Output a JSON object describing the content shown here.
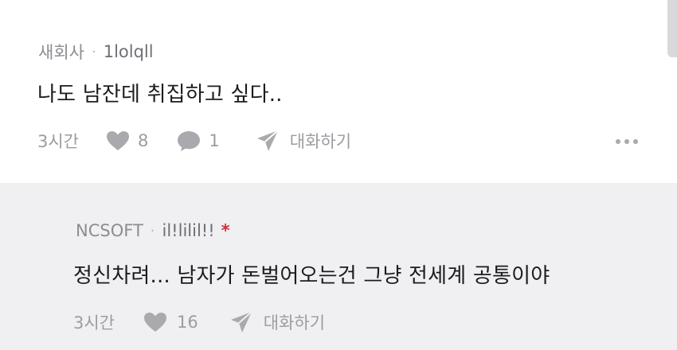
{
  "comments": [
    {
      "company": "새회사",
      "separator": "·",
      "nickname": "1lolqll",
      "text": "나도 남잔데 취집하고 싶다..",
      "time": "3시간",
      "likes": "8",
      "replies": "1",
      "converse_label": "대화하기"
    },
    {
      "company": "NCSOFT",
      "separator": "·",
      "nickname": "il!lilil!!",
      "badge": "*",
      "text": "정신차려... 남자가 돈벌어오는건 그냥 전세계 공통이야",
      "time": "3시간",
      "likes": "16",
      "converse_label": "대화하기"
    }
  ],
  "icons": {
    "like": "heart-icon",
    "reply": "speech-bubble-icon",
    "converse": "paper-plane-icon",
    "more": "more-horizontal-icon"
  },
  "colors": {
    "reply_background": "#f0f0f3",
    "badge": "#d62b3a",
    "icon_gray": "#a9a9ae"
  }
}
